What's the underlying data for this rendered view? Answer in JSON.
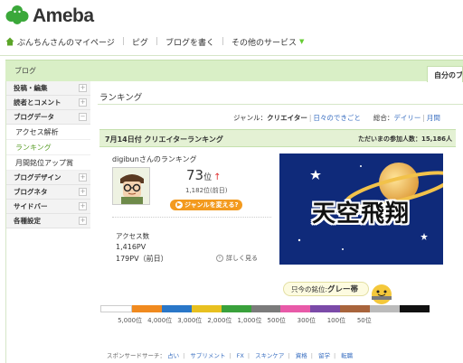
{
  "header": {
    "brand": "Ameba",
    "nav": [
      "ぶんちんさんのマイページ",
      "ピグ",
      "ブログを書く",
      "その他のサービス"
    ]
  },
  "blog_header": {
    "label": "ブログ",
    "my_tab": "自分のブ"
  },
  "sidebar": {
    "sections": [
      {
        "label": "投稿・編集",
        "toggle": "+"
      },
      {
        "label": "読者とコメント",
        "toggle": "+"
      },
      {
        "label": "ブログデータ",
        "toggle": "−"
      }
    ],
    "sub_items": [
      "アクセス解析",
      "ランキング",
      "月間銘位アップ賞"
    ],
    "more_sections": [
      {
        "label": "ブログデザイン",
        "toggle": "+"
      },
      {
        "label": "ブログネタ",
        "toggle": "+"
      },
      {
        "label": "サイドバー",
        "toggle": "+"
      },
      {
        "label": "各種設定",
        "toggle": "+"
      }
    ]
  },
  "main": {
    "title": "ランキング",
    "genre_prefix": "ジャンル：",
    "genre_current": "クリエイター",
    "genre_other": "日々のできごと",
    "overall_prefix": "総合：",
    "overall_daily": "デイリー",
    "overall_monthly": "月間",
    "rank_bar_left": "7月14日付 クリエイターランキング",
    "rank_bar_right": "ただいまの参加人数：15,186人",
    "user_ranking_title": "digibunさんのランキング",
    "rank": "73",
    "rank_suffix": "位",
    "rank_change": "↑",
    "prev_rank": "1,182位(前日)",
    "change_genre_button": "ジャンルを変える?",
    "access_label": "アクセス数",
    "pv_today": "1,416PV",
    "pv_prev": "179PV（前日）",
    "detail_link": "詳しく見る",
    "banner_title": "天空飛翔",
    "current_rank_prefix": "只今の銘位:",
    "current_rank_value": "グレー帯",
    "scale_colors": [
      "#ffffff",
      "#f08a1f",
      "#2a77c8",
      "#e8c020",
      "#39a13b",
      "#7b7b7b",
      "#e85aa8",
      "#7b4aa8",
      "#a8643c",
      "#bbbbbb",
      "#111111"
    ],
    "scale_ticks": [
      "5,000位",
      "4,000位",
      "3,000位",
      "2,000位",
      "1,000位",
      "500位",
      "300位",
      "100位",
      "50位"
    ],
    "sponsor_prefix": "スポンサードサーチ：",
    "sponsor_links": [
      "占い",
      "サプリメント",
      "FX",
      "スキンケア",
      "資格",
      "留学",
      "転職"
    ]
  }
}
